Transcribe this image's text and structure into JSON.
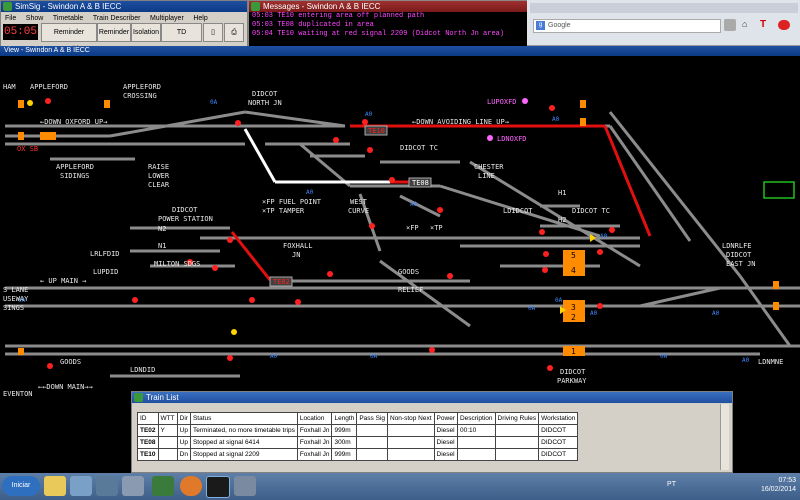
{
  "simsig": {
    "title": "SimSig - Swindon A & B IECC",
    "menu": [
      "File",
      "Show",
      "Timetable",
      "Train Describer",
      "Multiplayer",
      "Help"
    ],
    "clock": "05:05",
    "buttons": [
      "Reminder Override",
      "Reminder",
      "Isolation",
      "TD Interpose"
    ]
  },
  "messages": {
    "title": "Messages - Swindon A & B IECC",
    "lines": [
      "05:03 TE10 entering area off planned path",
      "05:03 TE08 duplicated in area",
      "05:04 TE10 waiting at red signal 2209 (Didcot North Jn area)"
    ]
  },
  "browser": {
    "search_placeholder": "Google"
  },
  "view": {
    "title": "View - Swindon A & B IECC",
    "labels": {
      "appleford": "APPLEFORD",
      "appleford_crossing_1": "APPLEFORD",
      "appleford_crossing_2": "CROSSING",
      "didcot_north_jn_1": "DIDCOT",
      "didcot_north_jn_2": "NORTH JN",
      "down_oxford_up": "←DOWN OXFORD UP→",
      "down_avoiding": "←DOWN AVOIDING LINE UP→",
      "lupoxfd": "LUPOXFD",
      "ldnoxfd": "LDNOXFD",
      "oxsb": "OX SB",
      "appleford_sidings_1": "APPLEFORD",
      "appleford_sidings_2": "SIDINGS",
      "raise": "RAISE",
      "lower": "LOWER",
      "clear": "CLEAR",
      "didcot_tc": "DIDCOT TC",
      "chester_line_1": "CHESTER",
      "chester_line_2": "LINE",
      "fp_fuel": "×FP FUEL POINT",
      "tp_tamper": "×TP TAMPER",
      "west_curve_1": "WEST",
      "west_curve_2": "CURVE",
      "fp": "×FP",
      "tp": "×TP",
      "ldidcot": "LDIDCOT",
      "didcot_tc2": "DIDCOT TC",
      "h1": "H1",
      "h2": "H2",
      "didcot_ps_1": "DIDCOT",
      "didcot_ps_2": "POWER STATION",
      "n2": "N2",
      "n1": "N1",
      "milton_sdgs": "MILTON SDGS",
      "foxhall_jn_1": "FOXHALL",
      "foxhall_jn_2": "JN",
      "lrlfdid": "LRLFDID",
      "lupdid": "LUPDID",
      "up_main": "← UP MAIN →",
      "goods": "GOODS",
      "relief": "RELIEF",
      "ldnrlfe_1": "LDNRLFE",
      "ldnrlfe_2": "DIDCOT",
      "ldnrlfe_3": "EAST JN",
      "s_lane": "S LANE",
      "useway": "USEWAY",
      "sings": "SINGS",
      "goods2": "GOODS",
      "ldndid": "LDNDID",
      "down_main": "←←DOWN MAIN→→",
      "eventon": "EVENTON",
      "didcot_parkway_1": "DIDCOT",
      "didcot_parkway_2": "PARKWAY",
      "ldnmne": "LDNMNE",
      "ham": "HAM",
      "platform_5": "5",
      "platform_4": "4",
      "platform_3": "3",
      "platform_2": "2",
      "platform_1": "1",
      "te10": "TE10",
      "te08": "TE08",
      "te02": "TE02"
    }
  },
  "train_list": {
    "title": "Train List",
    "columns": [
      "ID",
      "WTT",
      "Dir",
      "Status",
      "Location",
      "Length",
      "Pass Sig",
      "Non-stop Next",
      "Power",
      "Description",
      "Driving Rules",
      "Workstation"
    ],
    "rows": [
      [
        "TE02",
        "Y",
        "Up",
        "Terminated, no more timetable trips",
        "Foxhall Jn",
        "999m",
        "",
        "",
        "Diesel",
        "00:10",
        "",
        "DIDCOT"
      ],
      [
        "TE08",
        "",
        "Up",
        "Stopped at signal 6414",
        "Foxhall Jn",
        "300m",
        "",
        "",
        "Diesel",
        "",
        "",
        "DIDCOT"
      ],
      [
        "TE10",
        "",
        "Dn",
        "Stopped at signal 2209",
        "Foxhall Jn",
        "999m",
        "",
        "",
        "Diesel",
        "",
        "",
        "DIDCOT"
      ]
    ]
  },
  "taskbar": {
    "start": "Iniciar",
    "lang": "PT",
    "time": "07:53",
    "date": "16/02/2014"
  },
  "colors": {
    "track_idle": "#8c8c8c",
    "route_set": "#e01010",
    "route_white": "#ffffff",
    "signal_red": "#ff2020",
    "platform": "#ff8c00",
    "message_text": "#ff44ff"
  }
}
